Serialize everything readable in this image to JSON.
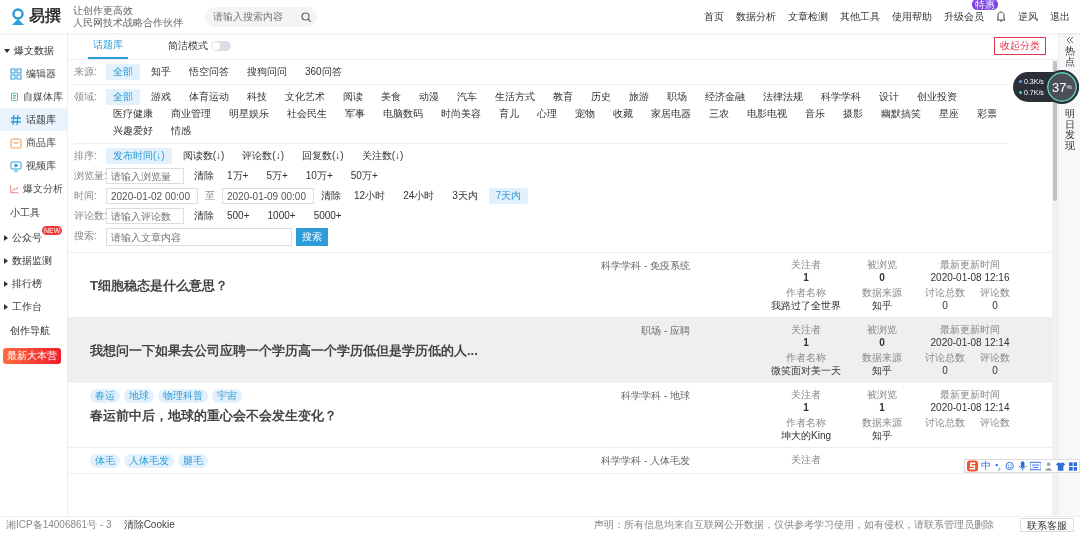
{
  "header": {
    "logo": "易撰",
    "taglines": [
      "让创作更高效",
      "人民网技术战略合作伙伴"
    ],
    "search": {
      "placeholder": "请输入搜索内容"
    },
    "nav": [
      {
        "label": "首页"
      },
      {
        "label": "数据分析"
      },
      {
        "label": "文章检测"
      },
      {
        "label": "其他工具"
      },
      {
        "label": "使用帮助"
      },
      {
        "label": "升级会员",
        "badge": "特惠"
      }
    ],
    "user": "逆风",
    "logout": "退出"
  },
  "sidebar": [
    {
      "kind": "group",
      "label": "爆文数据",
      "expanded": true
    },
    {
      "kind": "item",
      "label": "编辑器",
      "selected": false
    },
    {
      "kind": "item",
      "label": "自媒体库",
      "selected": false
    },
    {
      "kind": "item",
      "label": "话题库",
      "selected": true
    },
    {
      "kind": "item",
      "label": "商品库",
      "selected": false
    },
    {
      "kind": "item",
      "label": "视频库",
      "selected": false
    },
    {
      "kind": "item",
      "label": "爆文分析",
      "selected": false
    },
    {
      "kind": "plain",
      "label": "小工具"
    },
    {
      "kind": "group",
      "label": "公众号",
      "expanded": false,
      "badge": "NEW"
    },
    {
      "kind": "group",
      "label": "数据监测",
      "expanded": false
    },
    {
      "kind": "group",
      "label": "排行榜",
      "expanded": false
    },
    {
      "kind": "group",
      "label": "工作台",
      "expanded": false
    },
    {
      "kind": "plain",
      "label": "创作导航"
    },
    {
      "kind": "button",
      "label": "最新大本营"
    }
  ],
  "tabs": [
    {
      "label": "话题库",
      "selected": true
    }
  ],
  "concise_mode": {
    "label": "简洁模式",
    "on": false
  },
  "collapse_button": "收起分类",
  "filters": [
    {
      "kind": "options",
      "label": "来源:",
      "options": [
        {
          "text": "全部",
          "selected": true
        },
        {
          "text": "知乎",
          "selected": false
        },
        {
          "text": "悟空问答",
          "selected": false
        },
        {
          "text": "搜狗问问",
          "selected": false
        },
        {
          "text": "360问答",
          "selected": false
        }
      ]
    },
    {
      "kind": "options",
      "label": "领域:",
      "options": [
        {
          "text": "全部",
          "selected": true
        },
        {
          "text": "游戏",
          "selected": false
        },
        {
          "text": "体育运动",
          "selected": false
        },
        {
          "text": "科技",
          "selected": false
        },
        {
          "text": "文化艺术",
          "selected": false
        },
        {
          "text": "阅读",
          "selected": false
        },
        {
          "text": "美食",
          "selected": false
        },
        {
          "text": "动漫",
          "selected": false
        },
        {
          "text": "汽车",
          "selected": false
        },
        {
          "text": "生活方式",
          "selected": false
        },
        {
          "text": "教育",
          "selected": false
        },
        {
          "text": "历史",
          "selected": false
        },
        {
          "text": "旅游",
          "selected": false
        },
        {
          "text": "职场",
          "selected": false
        },
        {
          "text": "经济金融",
          "selected": false
        },
        {
          "text": "法律法规",
          "selected": false
        },
        {
          "text": "科学学科",
          "selected": false
        },
        {
          "text": "设计",
          "selected": false
        },
        {
          "text": "创业投资",
          "selected": false
        },
        {
          "text": "医疗健康",
          "selected": false
        },
        {
          "text": "商业管理",
          "selected": false
        },
        {
          "text": "明星娱乐",
          "selected": false
        },
        {
          "text": "社会民生",
          "selected": false
        },
        {
          "text": "军事",
          "selected": false
        },
        {
          "text": "电脑数码",
          "selected": false
        },
        {
          "text": "时尚美容",
          "selected": false
        },
        {
          "text": "育儿",
          "selected": false
        },
        {
          "text": "心理",
          "selected": false
        },
        {
          "text": "宠物",
          "selected": false
        },
        {
          "text": "收藏",
          "selected": false
        },
        {
          "text": "家居电器",
          "selected": false
        },
        {
          "text": "三农",
          "selected": false
        },
        {
          "text": "电影电视",
          "selected": false
        },
        {
          "text": "音乐",
          "selected": false
        },
        {
          "text": "摄影",
          "selected": false
        },
        {
          "text": "幽默搞笑",
          "selected": false
        },
        {
          "text": "星座",
          "selected": false
        },
        {
          "text": "彩票",
          "selected": false
        },
        {
          "text": "兴趣爱好",
          "selected": false
        },
        {
          "text": "情感",
          "selected": false
        }
      ]
    },
    {
      "kind": "options",
      "label": "排序:",
      "options": [
        {
          "text": "发布时间(↓)",
          "selected": true
        },
        {
          "text": "阅读数(↓)",
          "selected": false
        },
        {
          "text": "评论数(↓)",
          "selected": false
        },
        {
          "text": "回复数(↓)",
          "selected": false
        },
        {
          "text": "关注数(↓)",
          "selected": false
        }
      ]
    },
    {
      "kind": "range",
      "label": "浏览量:",
      "placeholder": "请输入浏览量",
      "clear": "清除",
      "options": [
        {
          "text": "1万+",
          "selected": false
        },
        {
          "text": "5万+",
          "selected": false
        },
        {
          "text": "10万+",
          "selected": false
        },
        {
          "text": "50万+",
          "selected": false
        }
      ]
    },
    {
      "kind": "dates",
      "label": "时间:",
      "start": "2020-01-02 00:00",
      "between": "至",
      "end": "2020-01-09 00:00",
      "clear": "清除",
      "options": [
        {
          "text": "12小时",
          "selected": false
        },
        {
          "text": "24小时",
          "selected": false
        },
        {
          "text": "3天内",
          "selected": false
        },
        {
          "text": "7天内",
          "selected": true
        }
      ]
    },
    {
      "kind": "range",
      "label": "评论数:",
      "placeholder": "请输入评论数",
      "clear": "清除",
      "options": [
        {
          "text": "500+",
          "selected": false
        },
        {
          "text": "1000+",
          "selected": false
        },
        {
          "text": "5000+",
          "selected": false
        }
      ]
    },
    {
      "kind": "search",
      "label": "搜索:",
      "placeholder": "请输入文章内容",
      "button": "搜索"
    }
  ],
  "cards": [
    {
      "category": "科学学科 - 免疫系统",
      "title": "T细胞稳态是什么意思？",
      "hovered": false,
      "stats": [
        {
          "label": "关注者",
          "value": "1"
        },
        {
          "label": "被浏览",
          "value": "0"
        },
        {
          "label": "最新更新时间",
          "value": "2020-01-08 12:16"
        },
        {
          "label": "作者名称",
          "value": "我路过了全世界"
        },
        {
          "label": "数据来源",
          "value": "知乎"
        },
        {
          "label": "讨论总数",
          "value": "0"
        },
        {
          "label": "评论数",
          "value": "0"
        }
      ]
    },
    {
      "category": "职场 - 应聘",
      "title": "我想问一下如果去公司应聘一个学历高一个学历低但是学历低的人...",
      "hovered": true,
      "stats": [
        {
          "label": "关注者",
          "value": "1"
        },
        {
          "label": "被浏览",
          "value": "0"
        },
        {
          "label": "最新更新时间",
          "value": "2020-01-08 12:14"
        },
        {
          "label": "作者名称",
          "value": "微笑面对美一天"
        },
        {
          "label": "数据来源",
          "value": "知乎"
        },
        {
          "label": "讨论总数",
          "value": "0"
        },
        {
          "label": "评论数",
          "value": "0"
        }
      ]
    },
    {
      "tags": [
        "春运",
        "地球",
        "物理科普",
        "宇宙"
      ],
      "category": "科学学科 - 地球",
      "title": "春运前中后，地球的重心会不会发生变化？",
      "hovered": false,
      "stats": [
        {
          "label": "关注者",
          "value": "1"
        },
        {
          "label": "被浏览",
          "value": "1"
        },
        {
          "label": "最新更新时间",
          "value": "2020-01-08 12:14"
        },
        {
          "label": "作者名称",
          "value": "坤大的King"
        },
        {
          "label": "数据来源",
          "value": "知乎"
        },
        {
          "label": "讨论总数"
        },
        {
          "label": "评论数"
        }
      ]
    },
    {
      "tags": [
        "体毛",
        "人体毛发",
        "腿毛"
      ],
      "category": "科学学科 - 人体毛发",
      "hovered": false,
      "stats": [
        {
          "label": "关注者"
        }
      ]
    }
  ],
  "right_rail": {
    "labels": [
      "热点",
      "明日发现"
    ]
  },
  "net_widget": {
    "speeds": [
      {
        "value": "0.3",
        "unit": "K/s"
      },
      {
        "value": "0.7",
        "unit": "K/s"
      }
    ],
    "usage": "37",
    "unit": "%"
  },
  "ime_bar": {
    "mode": "中"
  },
  "footer": {
    "icp": "湘ICP备14006861号 - 3",
    "cookie": "清除Cookie",
    "notice": "声明：所有信息均来自互联网公开数据，仅供参考学习使用，如有侵权，请联系管理员删除",
    "contact": "联系客服"
  }
}
